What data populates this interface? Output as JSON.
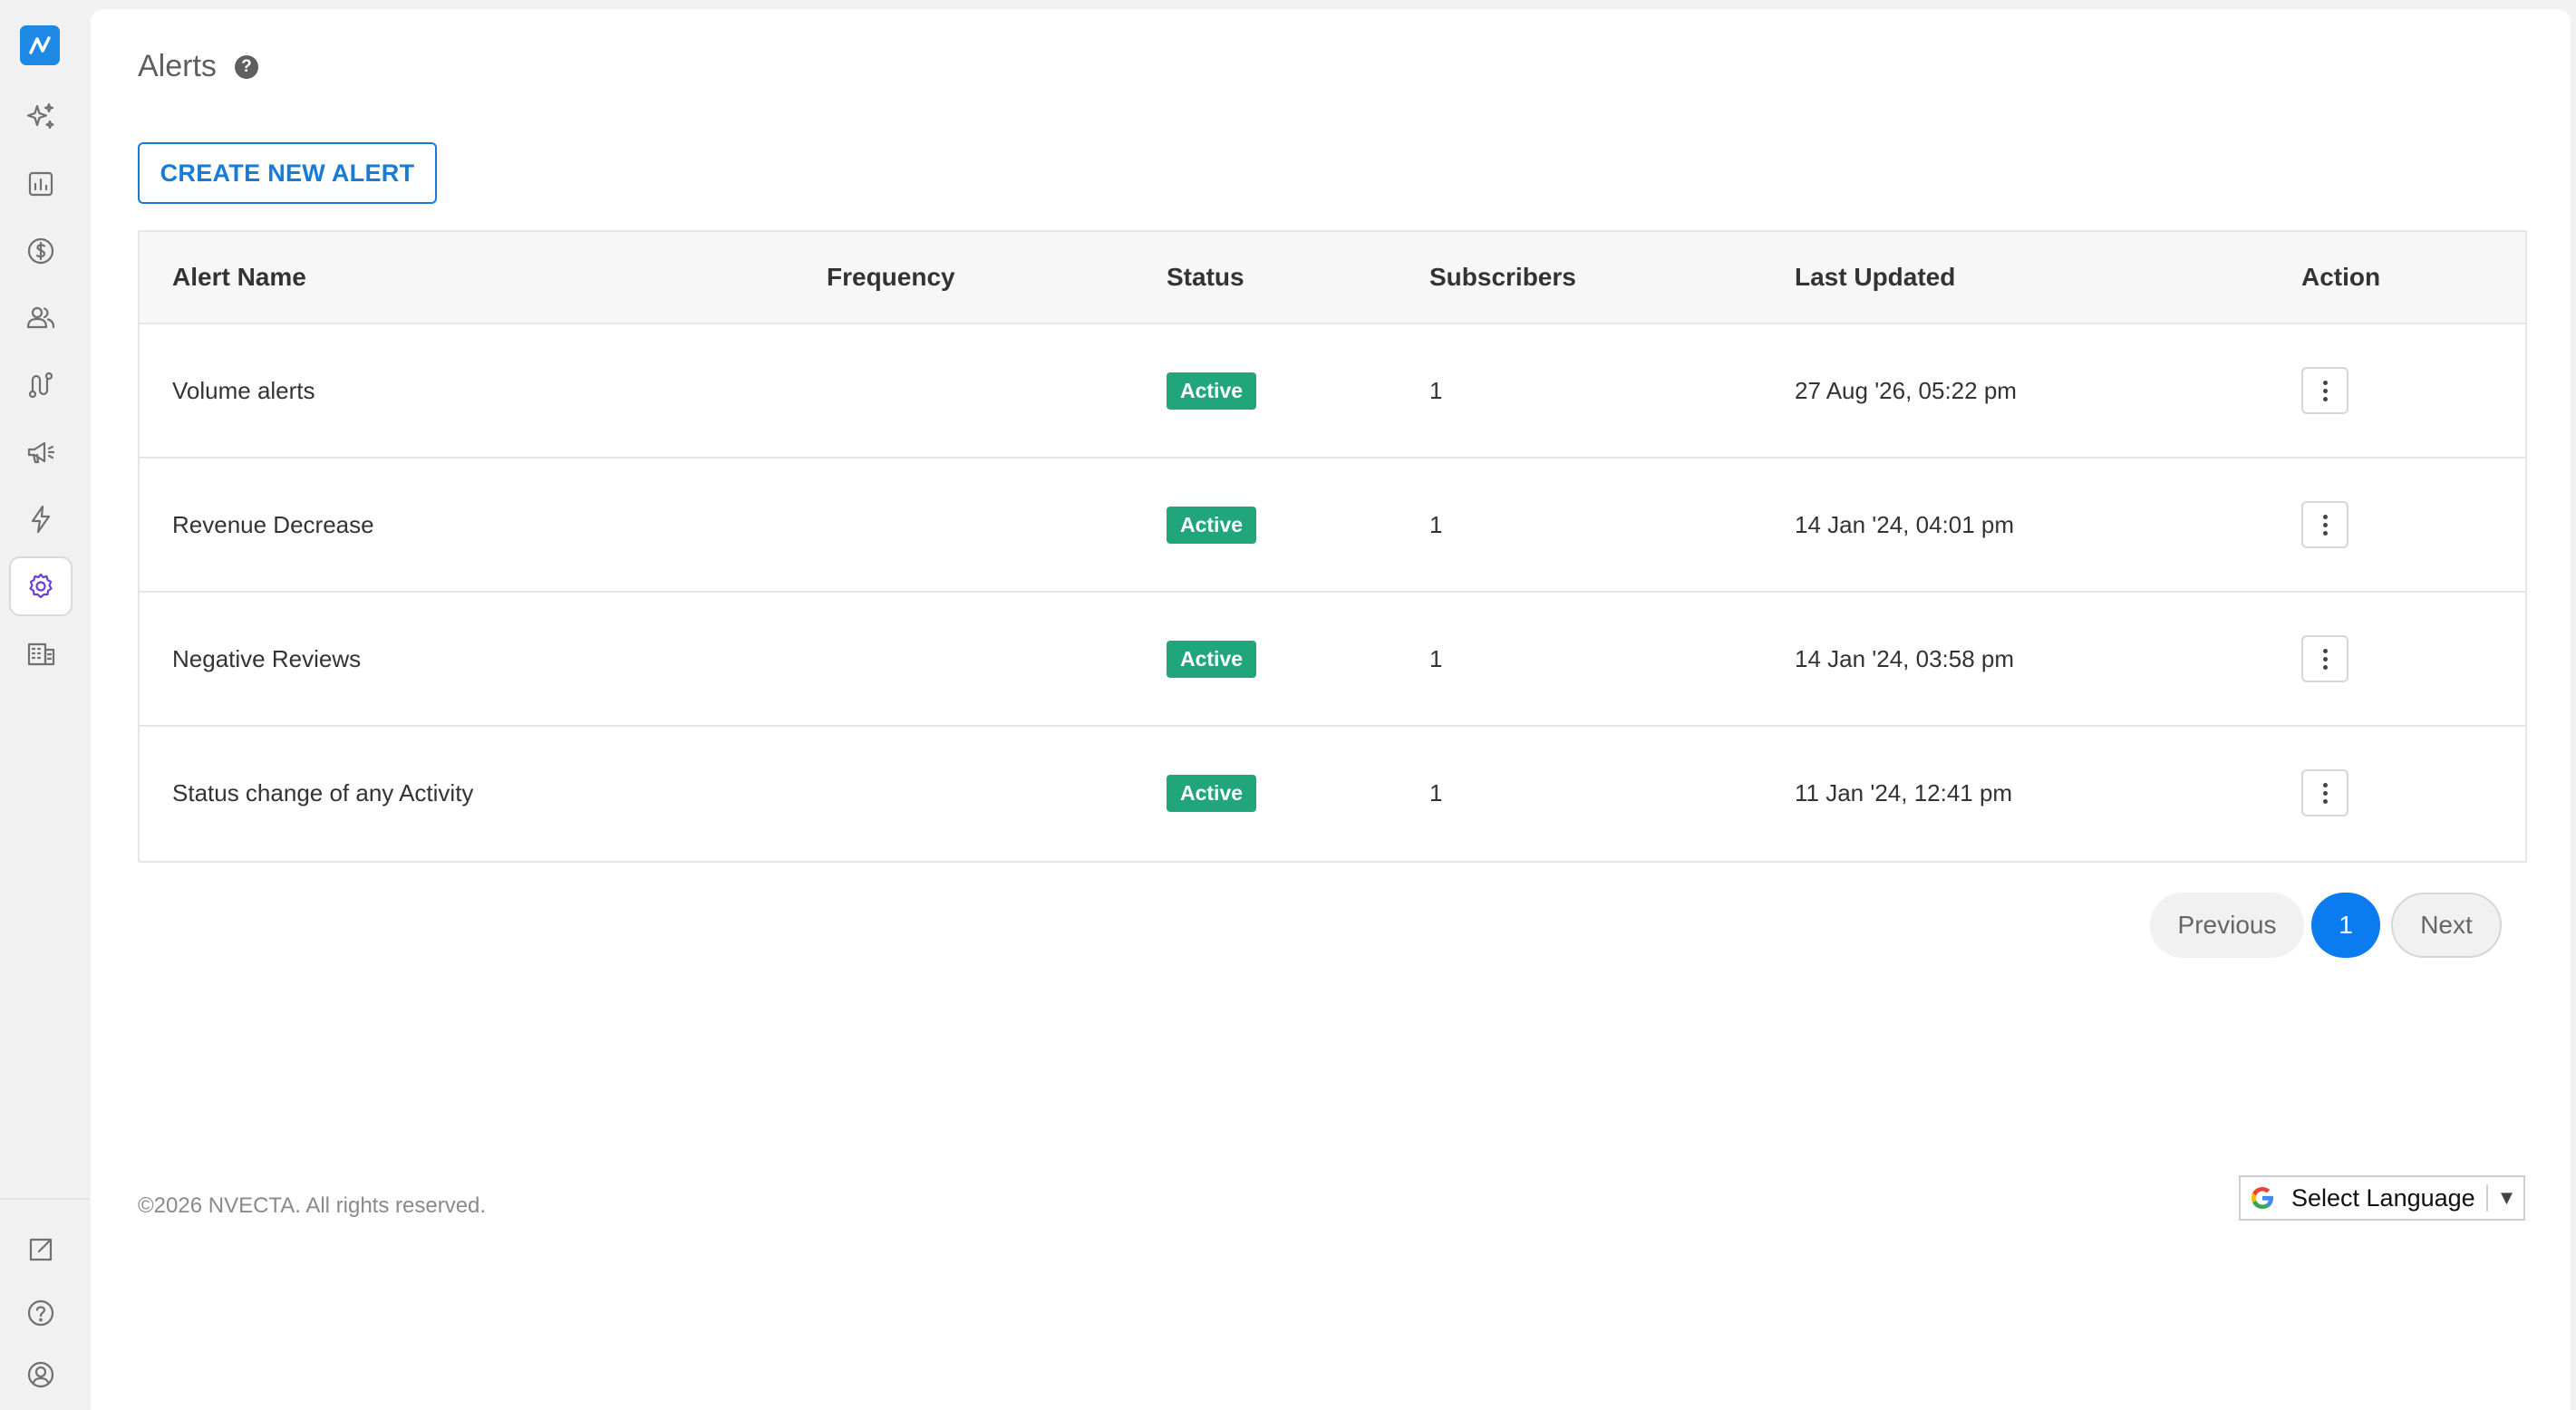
{
  "sidebar": {
    "items": [
      {
        "name": "sparkles-icon"
      },
      {
        "name": "chart-report-icon"
      },
      {
        "name": "dollar-icon"
      },
      {
        "name": "users-icon"
      },
      {
        "name": "route-icon"
      },
      {
        "name": "megaphone-icon"
      },
      {
        "name": "bolt-icon"
      },
      {
        "name": "gear-icon",
        "active": true
      },
      {
        "name": "building-icon"
      }
    ],
    "bottom": [
      {
        "name": "external-link-icon"
      },
      {
        "name": "help-circle-icon"
      },
      {
        "name": "user-circle-icon"
      }
    ],
    "accent": "#6a3fd6",
    "logo_color": "#1e88e5"
  },
  "page": {
    "title": "Alerts",
    "help_glyph": "?",
    "create_button": "CREATE NEW ALERT"
  },
  "table": {
    "columns": [
      "Alert Name",
      "Frequency",
      "Status",
      "Subscribers",
      "Last Updated",
      "Action"
    ],
    "rows": [
      {
        "name": "Volume alerts",
        "frequency": "",
        "status": "Active",
        "subscribers": "1",
        "updated": "27 Aug '26, 05:22 pm"
      },
      {
        "name": "Revenue Decrease",
        "frequency": "",
        "status": "Active",
        "subscribers": "1",
        "updated": "14 Jan '24, 04:01 pm"
      },
      {
        "name": "Negative Reviews",
        "frequency": "",
        "status": "Active",
        "subscribers": "1",
        "updated": "14 Jan '24, 03:58 pm"
      },
      {
        "name": "Status change of any Activity",
        "frequency": "",
        "status": "Active",
        "subscribers": "1",
        "updated": "11 Jan '24, 12:41 pm"
      }
    ],
    "status_color": "#20a67a"
  },
  "pagination": {
    "previous": "Previous",
    "current": "1",
    "next": "Next",
    "active_color": "#0b7bf0"
  },
  "footer": {
    "copyright": "©2026 NVECTA. All rights reserved.",
    "language_label": "Select Language",
    "language_arrow": "▼"
  }
}
